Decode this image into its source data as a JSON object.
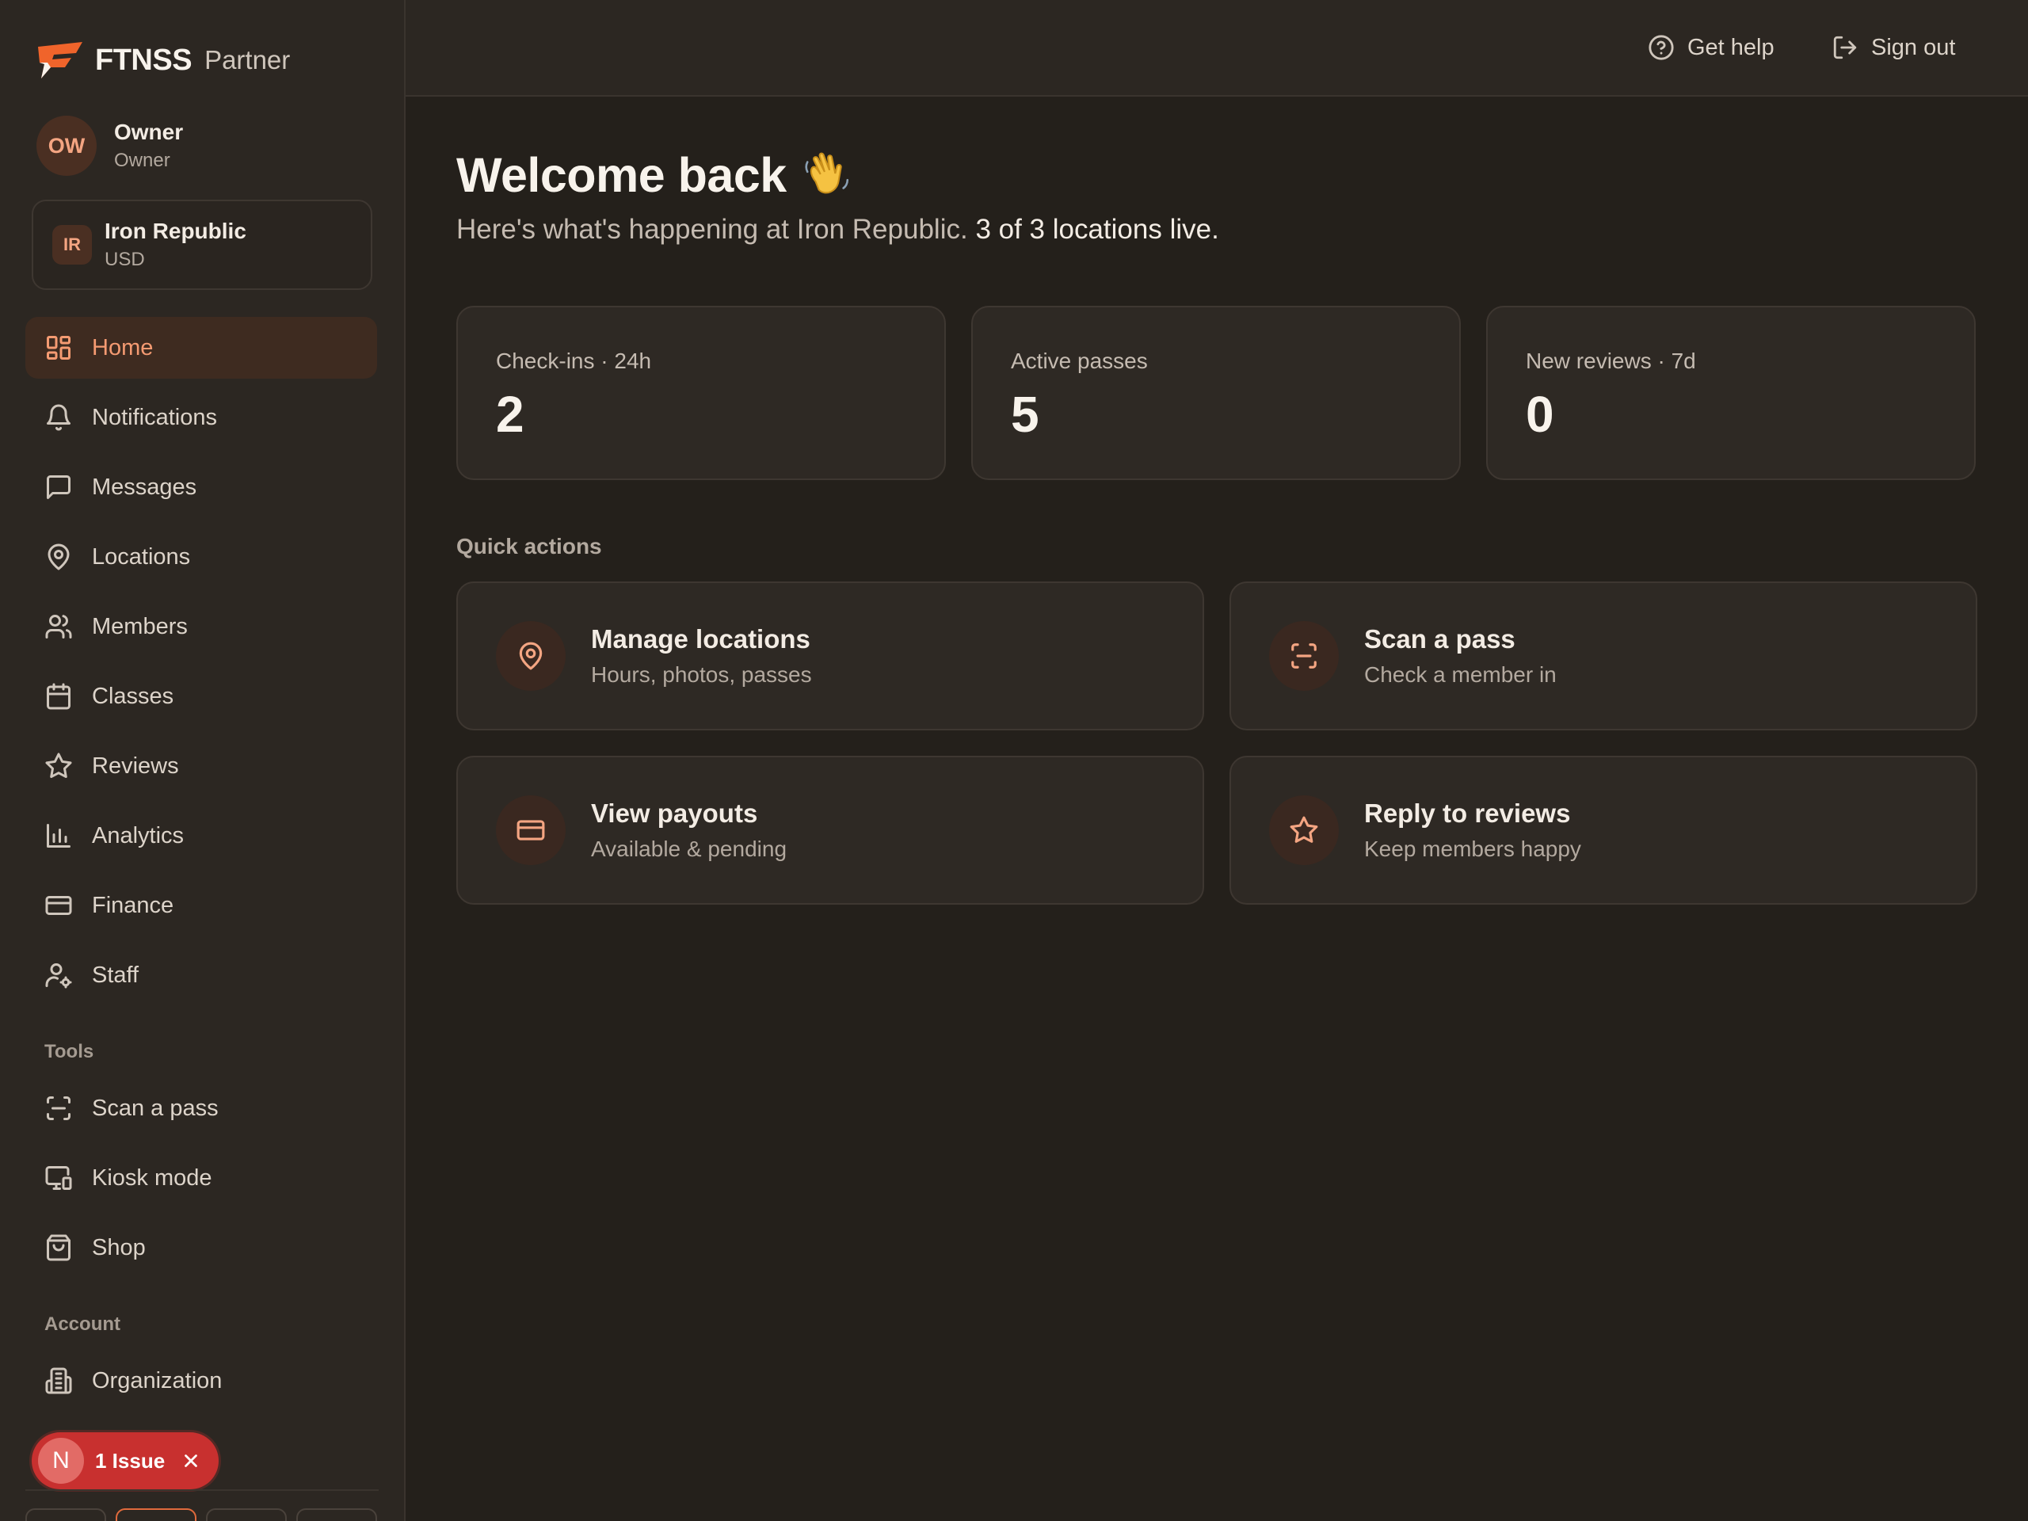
{
  "brand": {
    "name": "FTNSS",
    "sub": "Partner",
    "logo_color": "#f0642b"
  },
  "user": {
    "initials": "OW",
    "name": "Owner",
    "role": "Owner"
  },
  "org": {
    "initials": "IR",
    "name": "Iron Republic",
    "currency": "USD"
  },
  "nav": [
    {
      "label": "Home",
      "icon": "grid-icon",
      "active": true
    },
    {
      "label": "Notifications",
      "icon": "bell-icon"
    },
    {
      "label": "Messages",
      "icon": "message-icon"
    },
    {
      "label": "Locations",
      "icon": "map-pin-icon"
    },
    {
      "label": "Members",
      "icon": "users-icon"
    },
    {
      "label": "Classes",
      "icon": "calendar-icon"
    },
    {
      "label": "Reviews",
      "icon": "star-icon"
    },
    {
      "label": "Analytics",
      "icon": "bar-chart-icon"
    },
    {
      "label": "Finance",
      "icon": "credit-card-icon"
    },
    {
      "label": "Staff",
      "icon": "user-cog-icon"
    }
  ],
  "tools": {
    "label": "Tools",
    "items": [
      {
        "label": "Scan a pass",
        "icon": "scan-icon"
      },
      {
        "label": "Kiosk mode",
        "icon": "monitor-icon"
      },
      {
        "label": "Shop",
        "icon": "shopping-bag-icon"
      }
    ]
  },
  "account": {
    "label": "Account",
    "items": [
      {
        "label": "Organization",
        "icon": "building-icon"
      }
    ]
  },
  "issue": {
    "letter": "N",
    "text": "1 Issue"
  },
  "topbar": {
    "help": "Get help",
    "signout": "Sign out"
  },
  "main": {
    "title": "Welcome back",
    "subtitle_prefix": "Here's what's happening at Iron Republic.",
    "subtitle_highlight": "3 of 3 locations live.",
    "stats": [
      {
        "label": "Check-ins · 24h",
        "value": "2"
      },
      {
        "label": "Active passes",
        "value": "5"
      },
      {
        "label": "New reviews · 7d",
        "value": "0"
      }
    ],
    "quick_actions_title": "Quick actions",
    "actions": [
      {
        "title": "Manage locations",
        "sub": "Hours, photos, passes",
        "icon": "map-pin-icon"
      },
      {
        "title": "Scan a pass",
        "sub": "Check a member in",
        "icon": "scan-icon"
      },
      {
        "title": "View payouts",
        "sub": "Available & pending",
        "icon": "credit-card-icon"
      },
      {
        "title": "Reply to reviews",
        "sub": "Keep members happy",
        "icon": "star-icon"
      }
    ]
  },
  "colors": {
    "accent": "#f59b72",
    "accent_strong": "#e06a3c",
    "danger": "#c8302f"
  }
}
